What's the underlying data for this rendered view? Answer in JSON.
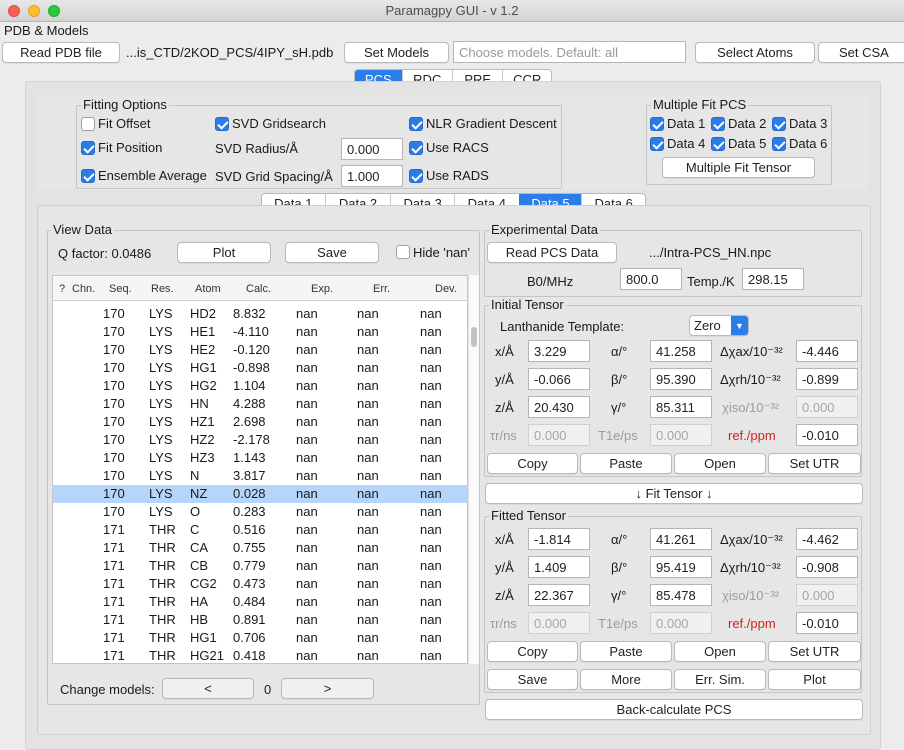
{
  "window": {
    "title": "Paramagpy GUI - v 1.2"
  },
  "pdb": {
    "section_label": "PDB & Models",
    "read_button": "Read PDB file",
    "file_path": "...is_CTD/2KOD_PCS/4IPY_sH.pdb",
    "set_models_button": "Set Models",
    "models_placeholder": "Choose models. Default: all",
    "select_atoms_button": "Select Atoms",
    "set_csa_button": "Set CSA"
  },
  "method_tabs": {
    "items": [
      "PCS",
      "RDC",
      "PRE",
      "CCR"
    ],
    "active": "PCS"
  },
  "fitting": {
    "title": "Fitting Options",
    "fit_offset": {
      "label": "Fit Offset",
      "checked": false
    },
    "fit_position": {
      "label": "Fit Position",
      "checked": true
    },
    "ensemble_average": {
      "label": "Ensemble Average",
      "checked": true
    },
    "svd_gridsearch": {
      "label": "SVD Gridsearch",
      "checked": true
    },
    "svd_radius_label": "SVD Radius/Å",
    "svd_radius_value": "0.000",
    "svd_spacing_label": "SVD Grid Spacing/Å",
    "svd_spacing_value": "1.000",
    "nlr": {
      "label": "NLR Gradient Descent",
      "checked": true
    },
    "racs": {
      "label": "Use RACS",
      "checked": true
    },
    "rads": {
      "label": "Use RADS",
      "checked": true
    }
  },
  "multiple_fit": {
    "title": "Multiple Fit PCS",
    "items": [
      "Data 1",
      "Data 2",
      "Data 3",
      "Data 4",
      "Data 5",
      "Data 6"
    ],
    "button": "Multiple Fit Tensor"
  },
  "data_tabs": {
    "items": [
      "Data 1",
      "Data 2",
      "Data 3",
      "Data 4",
      "Data 5",
      "Data 6"
    ],
    "active": "Data 5"
  },
  "view_data": {
    "title": "View Data",
    "q_factor": "Q factor: 0.0486",
    "plot_button": "Plot",
    "save_button": "Save",
    "hide_nan_label": "Hide 'nan'",
    "columns": [
      "?",
      "Chn.",
      "Seq.",
      "Res.",
      "Atom",
      "Calc.",
      "Exp.",
      "Err.",
      "Dev."
    ],
    "rows": [
      [
        "170",
        "LYS",
        "HD2",
        "8.832",
        "nan",
        "nan",
        "nan"
      ],
      [
        "170",
        "LYS",
        "HE1",
        "-4.110",
        "nan",
        "nan",
        "nan"
      ],
      [
        "170",
        "LYS",
        "HE2",
        "-0.120",
        "nan",
        "nan",
        "nan"
      ],
      [
        "170",
        "LYS",
        "HG1",
        "-0.898",
        "nan",
        "nan",
        "nan"
      ],
      [
        "170",
        "LYS",
        "HG2",
        "1.104",
        "nan",
        "nan",
        "nan"
      ],
      [
        "170",
        "LYS",
        "HN",
        "4.288",
        "nan",
        "nan",
        "nan"
      ],
      [
        "170",
        "LYS",
        "HZ1",
        "2.698",
        "nan",
        "nan",
        "nan"
      ],
      [
        "170",
        "LYS",
        "HZ2",
        "-2.178",
        "nan",
        "nan",
        "nan"
      ],
      [
        "170",
        "LYS",
        "HZ3",
        "1.143",
        "nan",
        "nan",
        "nan"
      ],
      [
        "170",
        "LYS",
        "N",
        "3.817",
        "nan",
        "nan",
        "nan"
      ],
      [
        "170",
        "LYS",
        "NZ",
        "0.028",
        "nan",
        "nan",
        "nan"
      ],
      [
        "170",
        "LYS",
        "O",
        "0.283",
        "nan",
        "nan",
        "nan"
      ],
      [
        "171",
        "THR",
        "C",
        "0.516",
        "nan",
        "nan",
        "nan"
      ],
      [
        "171",
        "THR",
        "CA",
        "0.755",
        "nan",
        "nan",
        "nan"
      ],
      [
        "171",
        "THR",
        "CB",
        "0.779",
        "nan",
        "nan",
        "nan"
      ],
      [
        "171",
        "THR",
        "CG2",
        "0.473",
        "nan",
        "nan",
        "nan"
      ],
      [
        "171",
        "THR",
        "HA",
        "0.484",
        "nan",
        "nan",
        "nan"
      ],
      [
        "171",
        "THR",
        "HB",
        "0.891",
        "nan",
        "nan",
        "nan"
      ],
      [
        "171",
        "THR",
        "HG1",
        "0.706",
        "nan",
        "nan",
        "nan"
      ],
      [
        "171",
        "THR",
        "HG21",
        "0.418",
        "nan",
        "nan",
        "nan"
      ]
    ],
    "selected_row_index": 10,
    "change_models_label": "Change models:",
    "prev_button": "<",
    "model_index": "0",
    "next_button": ">"
  },
  "experimental": {
    "title": "Experimental Data",
    "read_button": "Read PCS Data",
    "file_path": ".../Intra-PCS_HN.npc",
    "b0_label": "B0/MHz",
    "b0_value": "800.0",
    "temp_label": "Temp./K",
    "temp_value": "298.15"
  },
  "initial_tensor": {
    "title": "Initial Tensor",
    "template_label": "Lanthanide Template:",
    "template_value": "Zero",
    "x_label": "x/Å",
    "x": "3.229",
    "y_label": "y/Å",
    "y": "-0.066",
    "z_label": "z/Å",
    "z": "20.430",
    "alpha_label": "α/°",
    "alpha": "41.258",
    "beta_label": "β/°",
    "beta": "95.390",
    "gamma_label": "γ/°",
    "gamma": "85.311",
    "dax_label": "Δχax/10⁻³²",
    "dax": "-4.446",
    "drh_label": "Δχrh/10⁻³²",
    "drh": "-0.899",
    "iso_label": "χiso/10⁻³²",
    "iso": "0.000",
    "taur_label": "τr/ns",
    "taur": "0.000",
    "t1e_label": "T1e/ps",
    "t1e": "0.000",
    "ref_label": "ref./ppm",
    "ref": "-0.010",
    "buttons": [
      "Copy",
      "Paste",
      "Open",
      "Set UTR"
    ]
  },
  "fit_button": "↓  Fit Tensor  ↓",
  "fitted_tensor": {
    "title": "Fitted Tensor",
    "x_label": "x/Å",
    "x": "-1.814",
    "y_label": "y/Å",
    "y": "1.409",
    "z_label": "z/Å",
    "z": "22.367",
    "alpha_label": "α/°",
    "alpha": "41.261",
    "beta_label": "β/°",
    "beta": "95.419",
    "gamma_label": "γ/°",
    "gamma": "85.478",
    "dax_label": "Δχax/10⁻³²",
    "dax": "-4.462",
    "drh_label": "Δχrh/10⁻³²",
    "drh": "-0.908",
    "iso_label": "χiso/10⁻³²",
    "iso": "0.000",
    "taur_label": "τr/ns",
    "taur": "0.000",
    "t1e_label": "T1e/ps",
    "t1e": "0.000",
    "ref_label": "ref./ppm",
    "ref": "-0.010",
    "buttons": [
      "Copy",
      "Paste",
      "Open",
      "Set UTR"
    ],
    "buttons2": [
      "Save",
      "More",
      "Err. Sim.",
      "Plot"
    ]
  },
  "backcalc_button": "Back-calculate PCS",
  "colors": {
    "accent": "#2b7de9",
    "selection": "#b5d5fb",
    "ref_label": "#d4221c"
  }
}
